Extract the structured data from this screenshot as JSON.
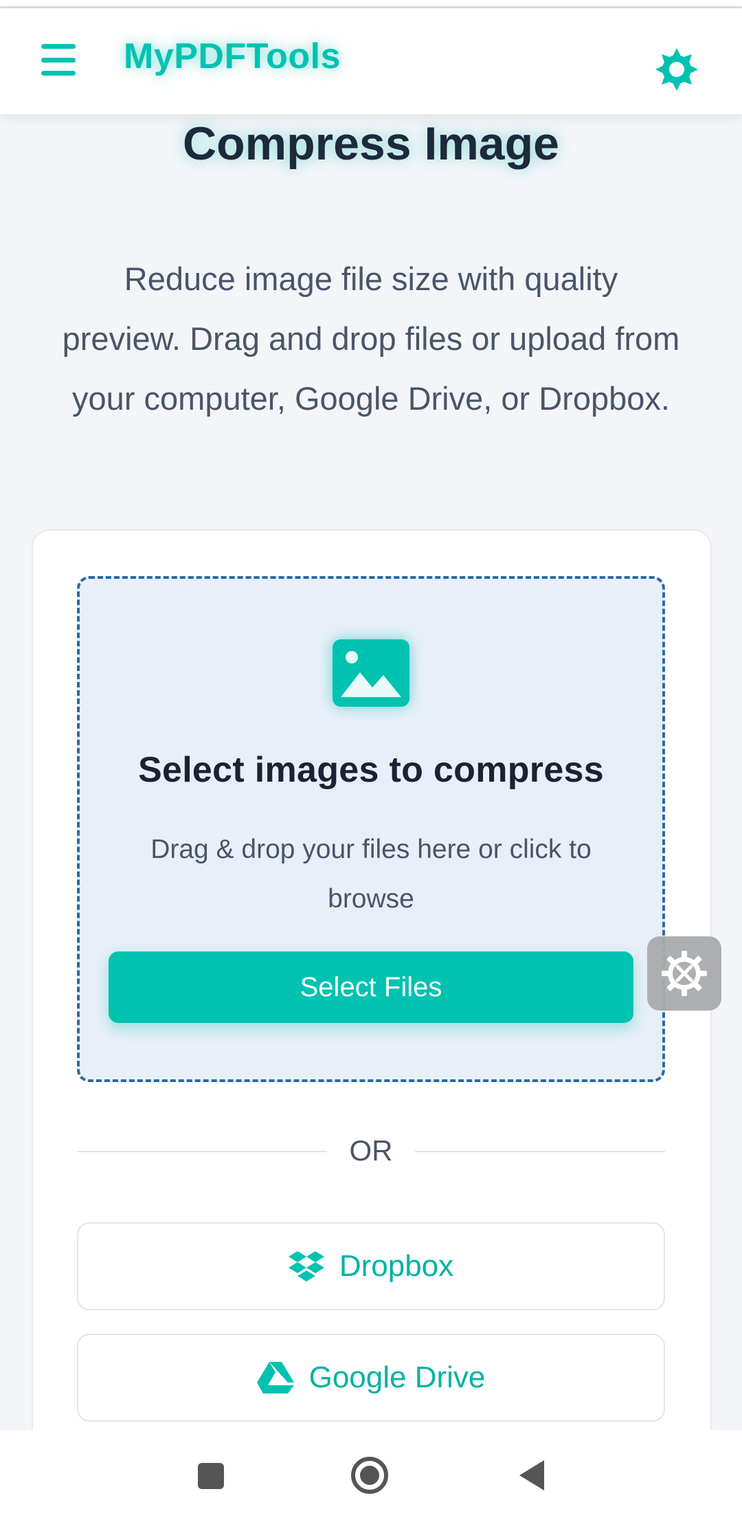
{
  "header": {
    "brand": "MyPDFTools",
    "menu_icon": "hamburger-menu-icon",
    "theme_icon": "sun-gear-icon"
  },
  "main": {
    "title": "Compress Image",
    "description": "Reduce image file size with quality preview. Drag and drop files or upload from your computer, Google Drive, or Dropbox."
  },
  "dropzone": {
    "icon": "image-icon",
    "title": "Select images to compress",
    "subtitle": "Drag & drop your files here or click to browse",
    "button_label": "Select Files"
  },
  "divider": {
    "text": "OR"
  },
  "providers": [
    {
      "label": "Dropbox",
      "icon": "dropbox-icon"
    },
    {
      "label": "Google Drive",
      "icon": "google-drive-icon"
    }
  ],
  "floating_tool": {
    "icon": "tools-gear-icon"
  },
  "navbar": {
    "recents_icon": "square-icon",
    "home_icon": "circle-icon",
    "back_icon": "triangle-back-icon"
  },
  "colors": {
    "accent": "#00c2b0",
    "dropzone_border": "#2b6aa3",
    "dropzone_bg": "#e8eff8",
    "page_bg": "#f3f5f9"
  }
}
